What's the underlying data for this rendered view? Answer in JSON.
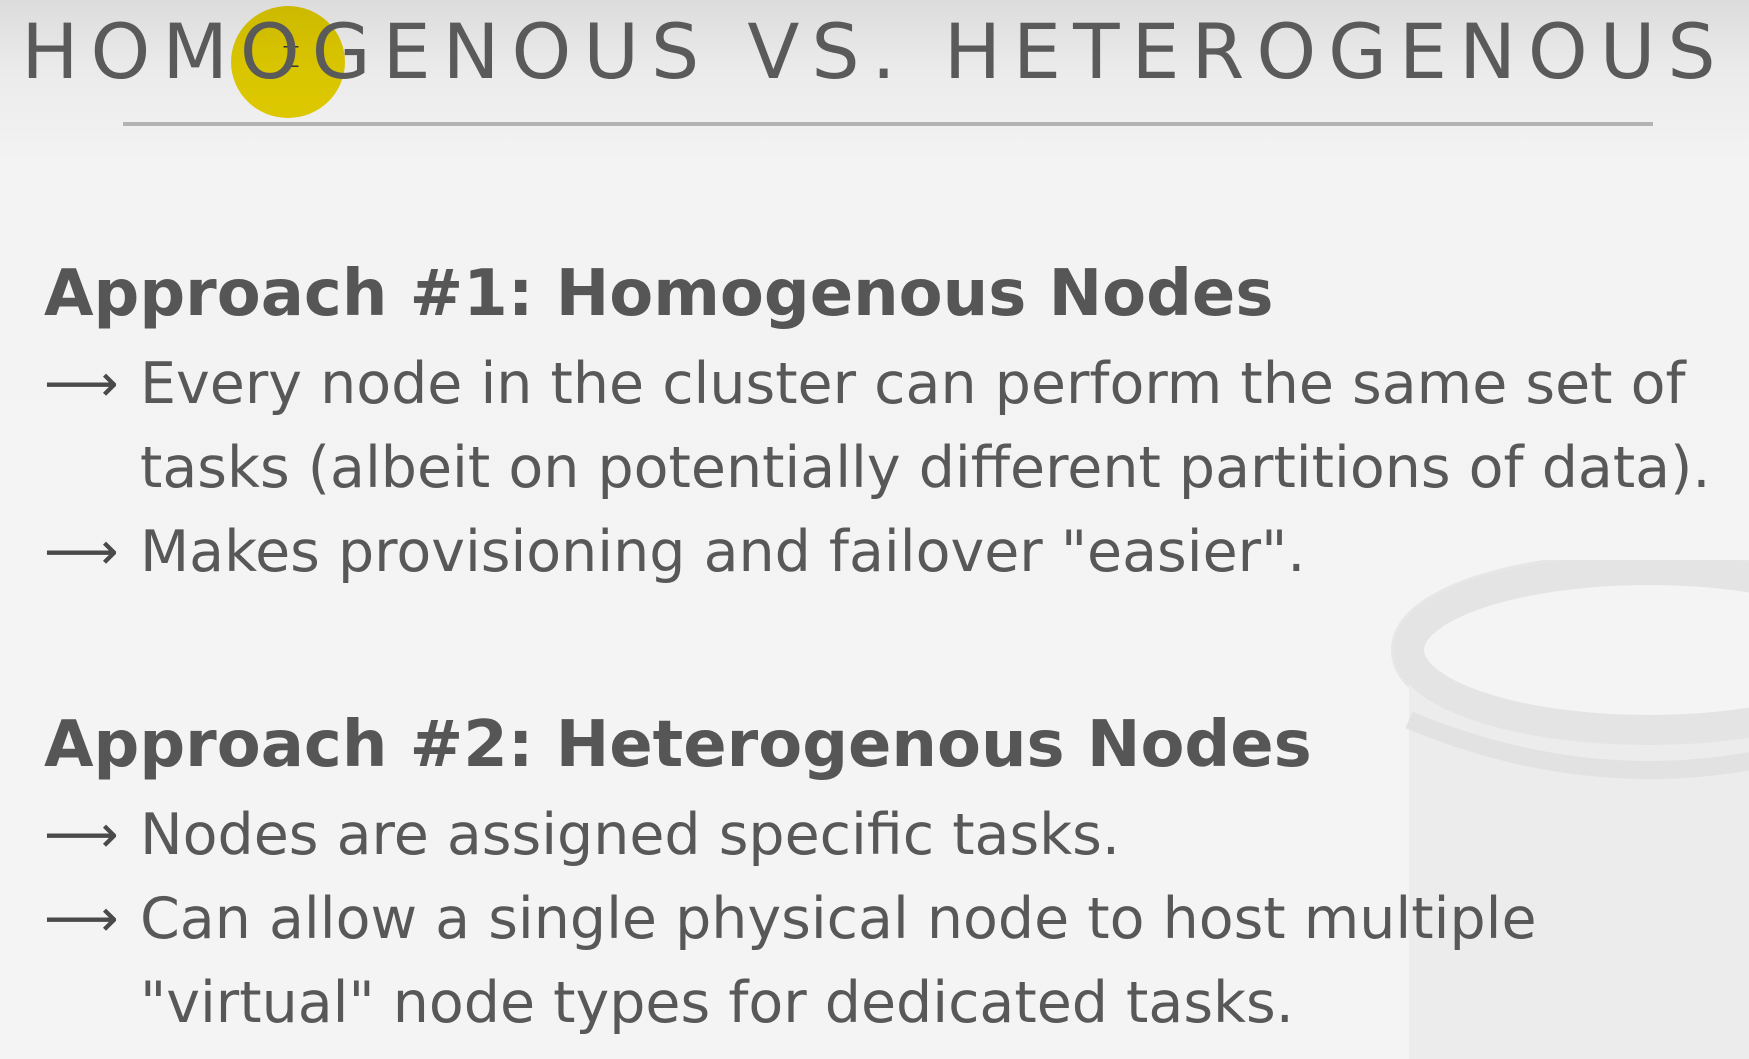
{
  "slide": {
    "title": "HOMOGENOUS VS. HETEROGENOUS",
    "sections": [
      {
        "heading": "Approach #1: Homogenous Nodes",
        "bullets": [
          {
            "lines": [
              "Every node in the cluster can perform the same set of",
              "tasks (albeit on potentially different partitions of data)."
            ]
          },
          {
            "lines": [
              "Makes provisioning and failover \"easier\"."
            ]
          }
        ]
      },
      {
        "heading": "Approach #2: Heterogenous Nodes",
        "bullets": [
          {
            "lines": [
              "Nodes are assigned specific tasks."
            ]
          },
          {
            "lines": [
              "Can allow a single physical node to host multiple",
              "\"virtual\" node types for dedicated tasks."
            ]
          }
        ]
      }
    ],
    "bullet_glyph": "⟶"
  },
  "pointer": {
    "color": "#ecd600"
  }
}
